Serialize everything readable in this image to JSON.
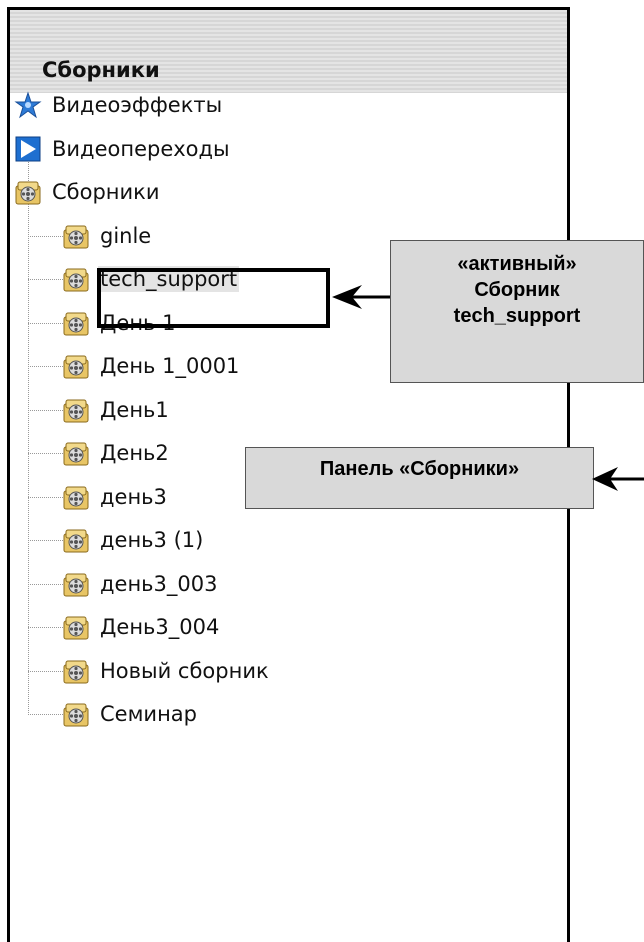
{
  "panel": {
    "title": "Сборники",
    "tree": [
      {
        "label": "Видеоэффекты",
        "icon": "effects-star-icon",
        "level": 0
      },
      {
        "label": "Видеопереходы",
        "icon": "transitions-play-icon",
        "level": 0
      },
      {
        "label": "Сборники",
        "icon": "collection-film-icon",
        "level": 0
      },
      {
        "label": "ginle",
        "icon": "collection-film-icon",
        "level": 1
      },
      {
        "label": "tech_support",
        "icon": "collection-film-icon",
        "level": 1,
        "selected": true
      },
      {
        "label": "День 1",
        "icon": "collection-film-icon",
        "level": 1
      },
      {
        "label": "День 1_0001",
        "icon": "collection-film-icon",
        "level": 1
      },
      {
        "label": "День1",
        "icon": "collection-film-icon",
        "level": 1
      },
      {
        "label": "День2",
        "icon": "collection-film-icon",
        "level": 1
      },
      {
        "label": "день3",
        "icon": "collection-film-icon",
        "level": 1
      },
      {
        "label": "день3 (1)",
        "icon": "collection-film-icon",
        "level": 1
      },
      {
        "label": "день3_003",
        "icon": "collection-film-icon",
        "level": 1
      },
      {
        "label": "День3_004",
        "icon": "collection-film-icon",
        "level": 1
      },
      {
        "label": "Новый сборник",
        "icon": "collection-film-icon",
        "level": 1
      },
      {
        "label": "Семинар",
        "icon": "collection-film-icon",
        "level": 1
      }
    ]
  },
  "annotations": {
    "active_line1": "«активный»",
    "active_line2": "Сборник",
    "active_line3": "tech_support",
    "panel_label": "Панель «Сборники»"
  }
}
